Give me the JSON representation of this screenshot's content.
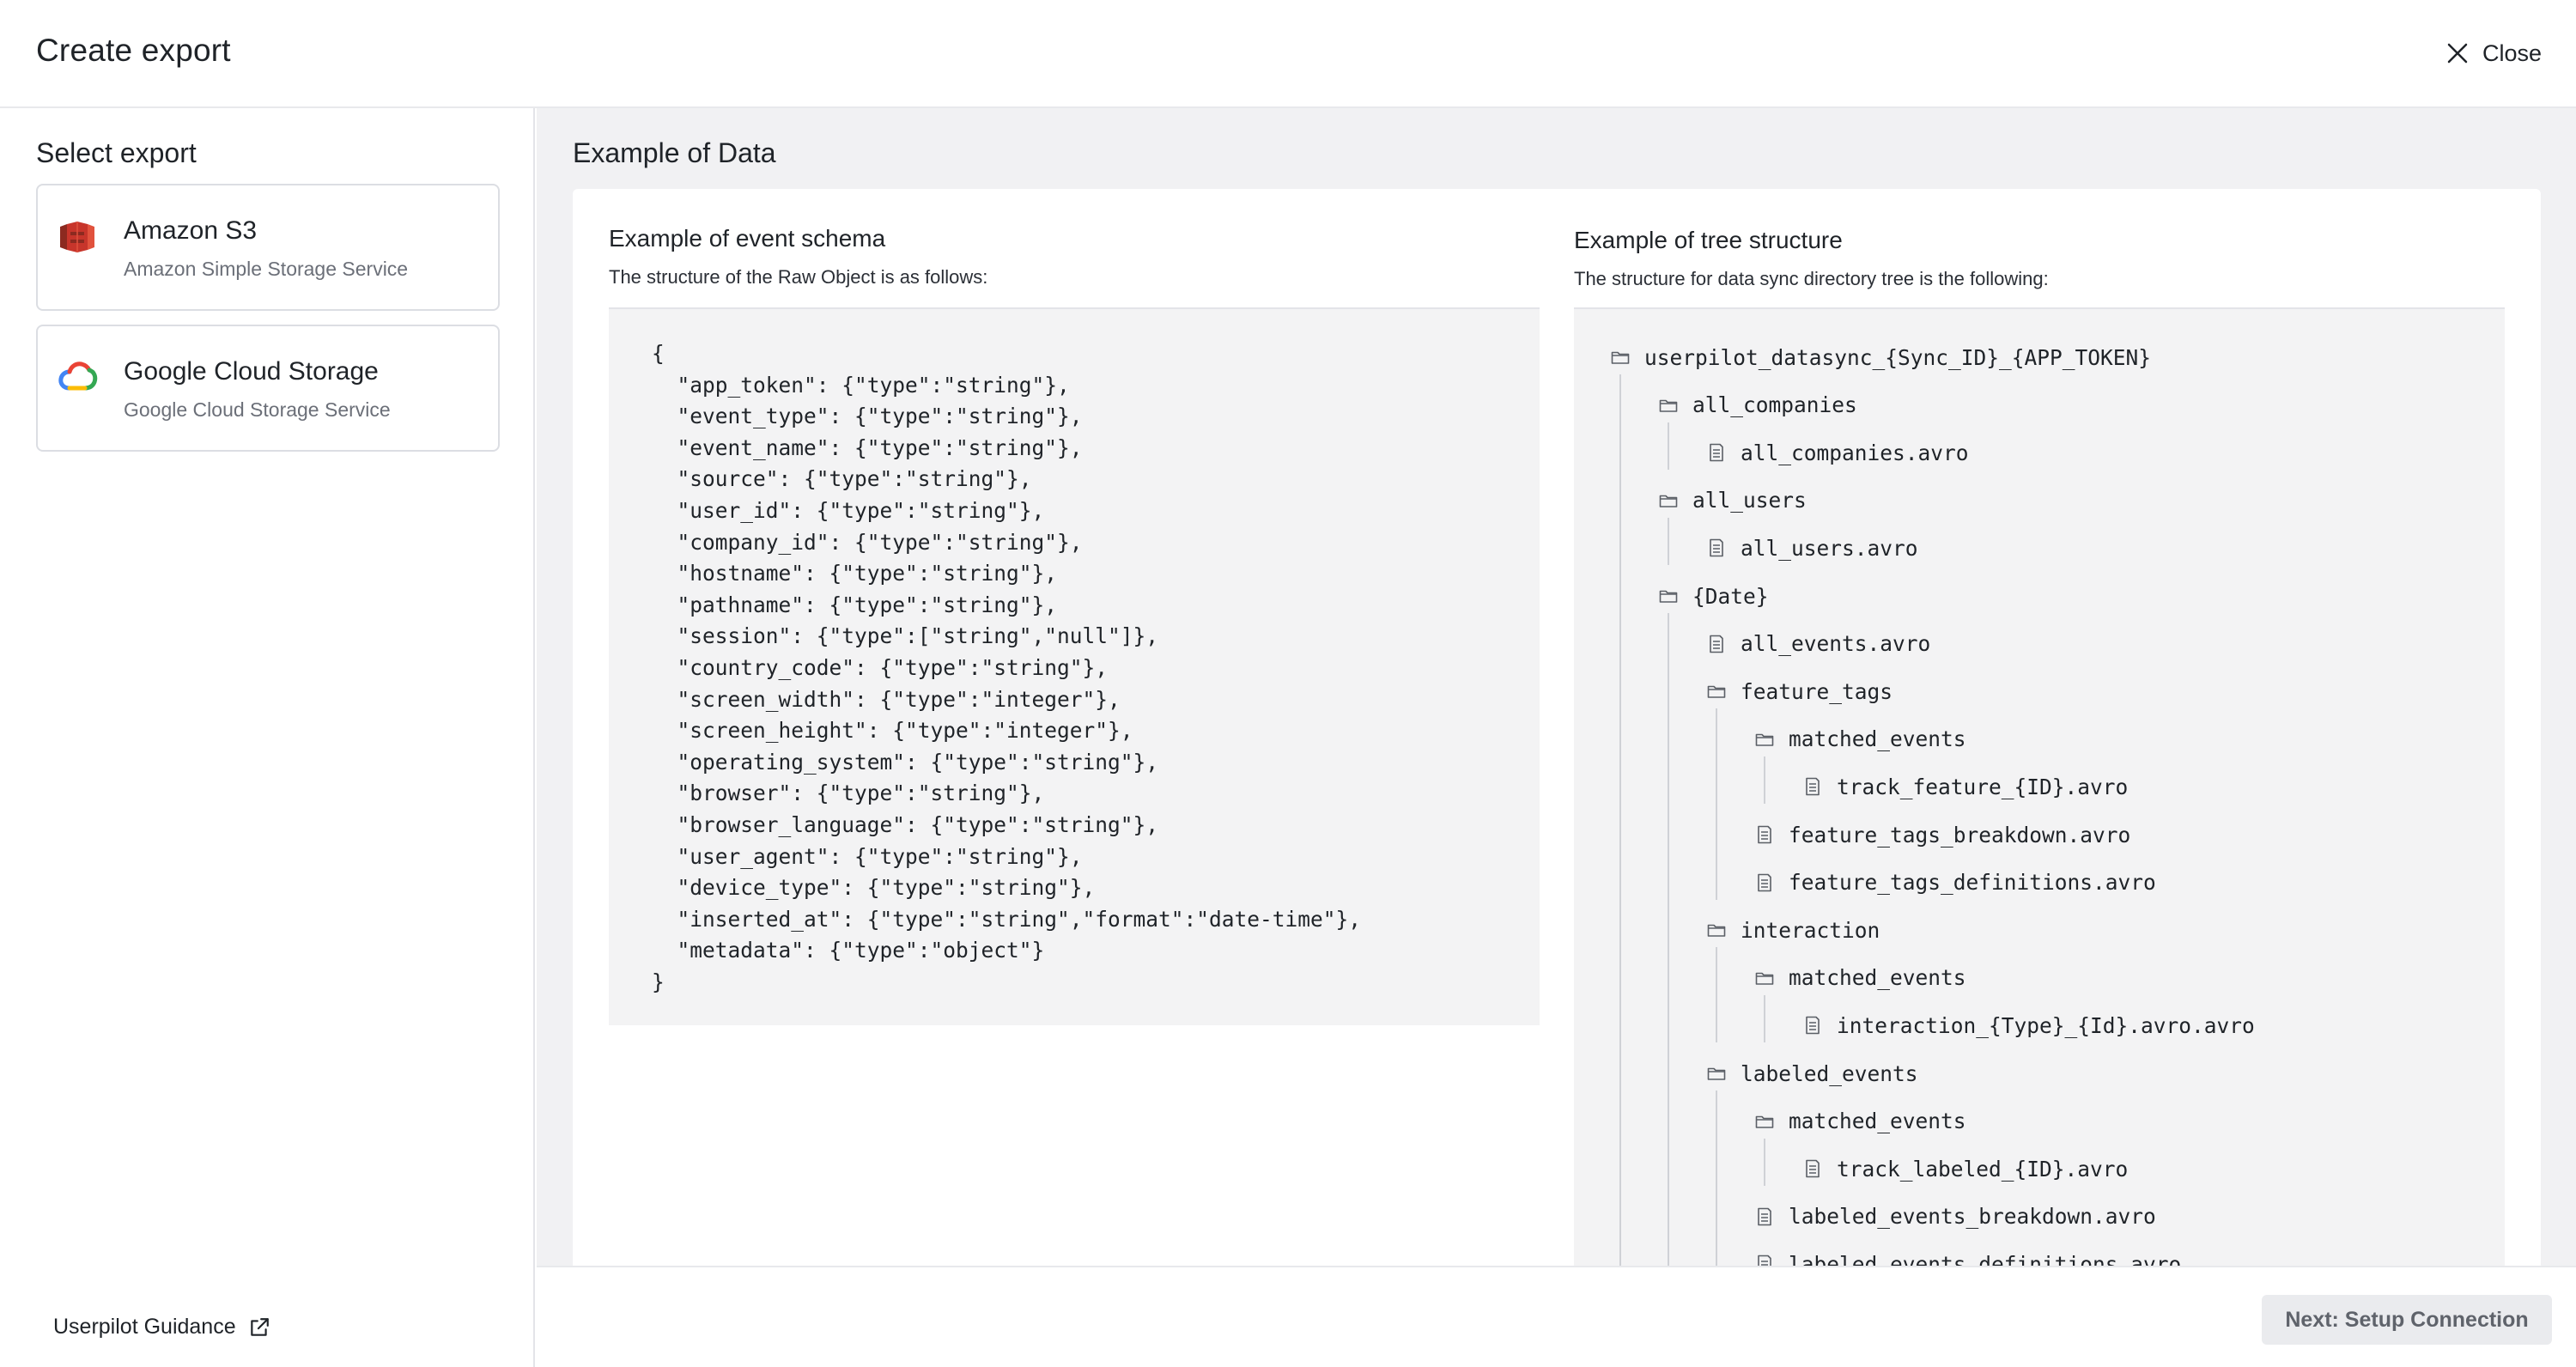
{
  "header": {
    "title": "Create export",
    "close_label": "Close"
  },
  "sidebar": {
    "section_title": "Select export",
    "exports": [
      {
        "name": "Amazon S3",
        "description": "Amazon Simple Storage Service",
        "icon": "amazon-s3-icon"
      },
      {
        "name": "Google Cloud Storage",
        "description": "Google Cloud Storage Service",
        "icon": "google-cloud-icon"
      }
    ],
    "guidance_label": "Userpilot Guidance"
  },
  "main": {
    "section_title": "Example of Data",
    "schema": {
      "title": "Example of event schema",
      "subtitle": "The structure of the Raw Object is as follows:",
      "code": "{\n  \"app_token\": {\"type\":\"string\"},\n  \"event_type\": {\"type\":\"string\"},\n  \"event_name\": {\"type\":\"string\"},\n  \"source\": {\"type\":\"string\"},\n  \"user_id\": {\"type\":\"string\"},\n  \"company_id\": {\"type\":\"string\"},\n  \"hostname\": {\"type\":\"string\"},\n  \"pathname\": {\"type\":\"string\"},\n  \"session\": {\"type\":[\"string\",\"null\"]},\n  \"country_code\": {\"type\":\"string\"},\n  \"screen_width\": {\"type\":\"integer\"},\n  \"screen_height\": {\"type\":\"integer\"},\n  \"operating_system\": {\"type\":\"string\"},\n  \"browser\": {\"type\":\"string\"},\n  \"browser_language\": {\"type\":\"string\"},\n  \"user_agent\": {\"type\":\"string\"},\n  \"device_type\": {\"type\":\"string\"},\n  \"inserted_at\": {\"type\":\"string\",\"format\":\"date-time\"},\n  \"metadata\": {\"type\":\"object\"}\n}"
    },
    "tree": {
      "title": "Example of tree structure",
      "subtitle": "The structure for data sync directory tree is the following:",
      "items": [
        {
          "label": "userpilot_datasync_{Sync_ID}_{APP_TOKEN}",
          "kind": "folder",
          "depth": 0
        },
        {
          "label": "all_companies",
          "kind": "folder",
          "depth": 1
        },
        {
          "label": "all_companies.avro",
          "kind": "file",
          "depth": 2
        },
        {
          "label": "all_users",
          "kind": "folder",
          "depth": 1
        },
        {
          "label": "all_users.avro",
          "kind": "file",
          "depth": 2
        },
        {
          "label": "{Date}",
          "kind": "folder",
          "depth": 1
        },
        {
          "label": "all_events.avro",
          "kind": "file",
          "depth": 2
        },
        {
          "label": "feature_tags",
          "kind": "folder",
          "depth": 2
        },
        {
          "label": "matched_events",
          "kind": "folder",
          "depth": 3
        },
        {
          "label": "track_feature_{ID}.avro",
          "kind": "file",
          "depth": 4
        },
        {
          "label": "feature_tags_breakdown.avro",
          "kind": "file",
          "depth": 3
        },
        {
          "label": "feature_tags_definitions.avro",
          "kind": "file",
          "depth": 3
        },
        {
          "label": "interaction",
          "kind": "folder",
          "depth": 2
        },
        {
          "label": "matched_events",
          "kind": "folder",
          "depth": 3
        },
        {
          "label": "interaction_{Type}_{Id}.avro.avro",
          "kind": "file",
          "depth": 4
        },
        {
          "label": "labeled_events",
          "kind": "folder",
          "depth": 2
        },
        {
          "label": "matched_events",
          "kind": "folder",
          "depth": 3
        },
        {
          "label": "track_labeled_{ID}.avro",
          "kind": "file",
          "depth": 4
        },
        {
          "label": "labeled_events_breakdown.avro",
          "kind": "file",
          "depth": 3
        },
        {
          "label": "labeled_events_definitions.avro",
          "kind": "file",
          "depth": 3
        }
      ]
    }
  },
  "footer": {
    "next_label": "Next: Setup Connection"
  },
  "colors": {
    "accent_bg": "#f1f1f3",
    "border": "#dcdee3",
    "s3_red": "#c7352b",
    "button_disabled": "#eaebee"
  }
}
